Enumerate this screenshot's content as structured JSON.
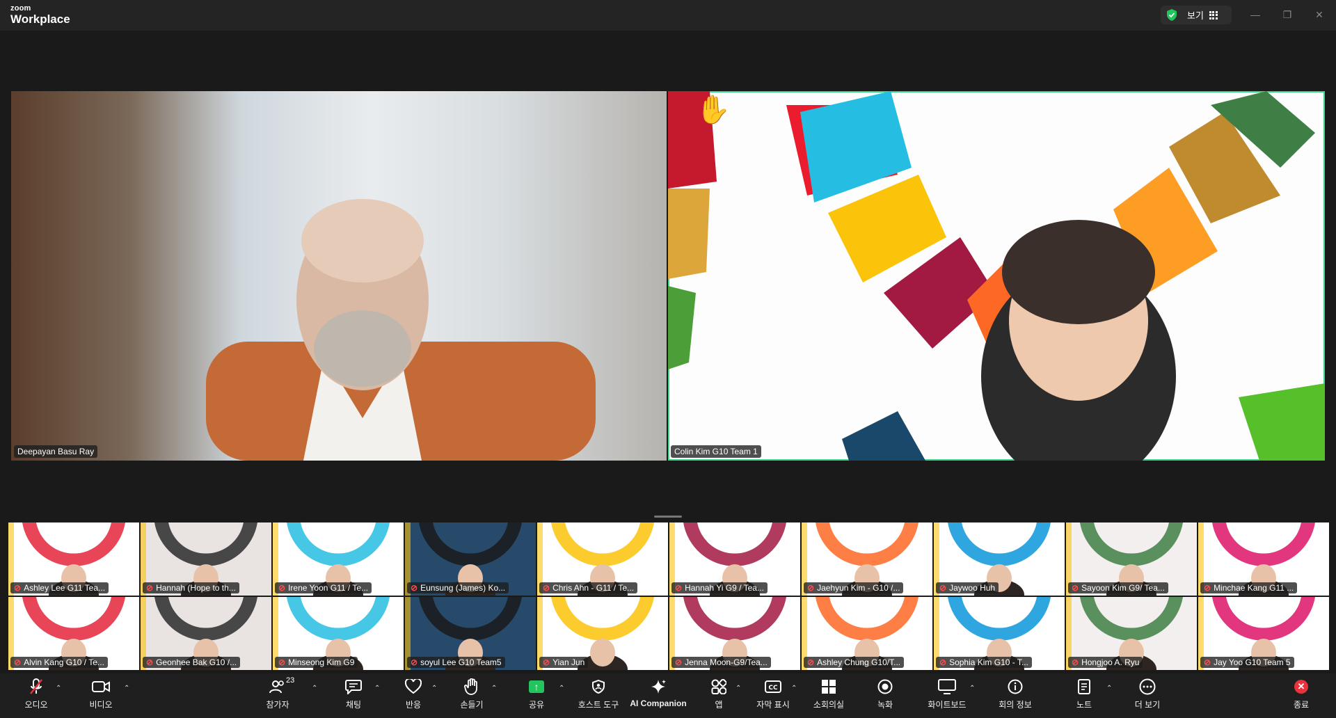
{
  "app": {
    "brand_small": "zoom",
    "brand_large": "Workplace",
    "view_label": "보기"
  },
  "speakers": [
    {
      "name": "Deepayan Basu Ray"
    },
    {
      "name": "Colin Kim G10 Team 1"
    }
  ],
  "participants_row1": [
    {
      "name": "Ashley Lee G11 Tea..."
    },
    {
      "name": "Hannah (Hope to th..."
    },
    {
      "name": "Irene Yoon G11 / Te..."
    },
    {
      "name": "Eunsung (James) Ko..."
    },
    {
      "name": "Chris Ahn - G11 / Te..."
    },
    {
      "name": "Hannah Yi G9 / Tea..."
    },
    {
      "name": "Jaehyun Kim - G10 /..."
    },
    {
      "name": "Jaywoo Huh"
    },
    {
      "name": "Sayoon Kim G9/ Tea..."
    },
    {
      "name": "Minchae Kang G11 ..."
    }
  ],
  "participants_row2": [
    {
      "name": "Alvin Kang G10 / Te..."
    },
    {
      "name": "Geonhee Bak G10 /..."
    },
    {
      "name": "Minseong Kim G9"
    },
    {
      "name": "soyul Lee G10 Team5"
    },
    {
      "name": "Yian Jun"
    },
    {
      "name": "Jenna Moon-G9/Tea..."
    },
    {
      "name": "Ashley Chung G10/T..."
    },
    {
      "name": "Sophia Kim G10 - T..."
    },
    {
      "name": "Hongjoo A. Ryu"
    },
    {
      "name": "Jay Yoo G10 Team 5"
    }
  ],
  "toolbar": {
    "audio": "오디오",
    "video": "비디오",
    "participants": "참가자",
    "participants_count": "23",
    "chat": "채팅",
    "reactions": "반응",
    "raise_hand": "손들기",
    "share": "공유",
    "host_tools": "호스트 도구",
    "ai_companion": "AI Companion",
    "apps": "앱",
    "captions": "자막 표시",
    "breakout": "소회의실",
    "record": "녹화",
    "whiteboard": "화이트보드",
    "meeting_info": "회의 정보",
    "notes": "노트",
    "more": "더 보기",
    "end": "종료"
  },
  "colors": {
    "active_speaker_border": "#3fd68a",
    "share_green": "#21c45d",
    "end_red": "#e8323c",
    "mic_off_red": "#ff4d4d"
  }
}
